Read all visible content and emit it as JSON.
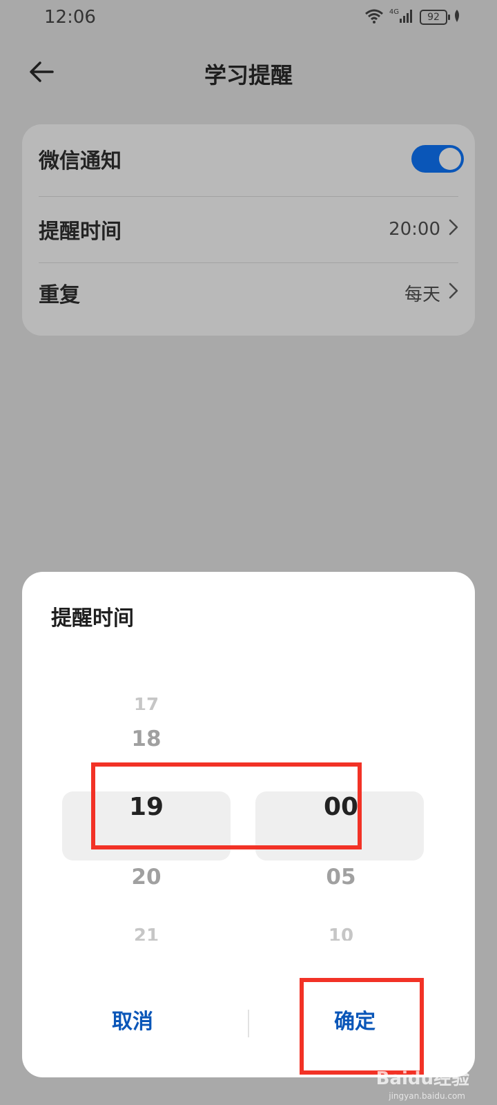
{
  "status_bar": {
    "time": "12:06",
    "network": "4G",
    "battery": "92",
    "icons": [
      "wifi-icon",
      "signal-icon",
      "battery-icon",
      "leaf-icon"
    ]
  },
  "header": {
    "title": "学习提醒",
    "back_icon": "arrow-left-icon"
  },
  "settings": {
    "wechat_notify": {
      "label": "微信通知",
      "toggle_on": true
    },
    "remind_time": {
      "label": "提醒时间",
      "value": "20:00"
    },
    "repeat": {
      "label": "重复",
      "value": "每天"
    }
  },
  "dialog": {
    "title": "提醒时间",
    "hours": {
      "above2": "17",
      "above1": "18",
      "selected": "19",
      "below1": "20",
      "below2": "21"
    },
    "minutes": {
      "selected": "00",
      "below1": "05",
      "below2": "10"
    },
    "cancel_label": "取消",
    "confirm_label": "确定"
  },
  "colors": {
    "accent": "#0a56b8",
    "highlight": "#f23226",
    "scrim": "#a9a9a9"
  },
  "watermark": {
    "text": "Baidu经验",
    "url": "jingyan.baidu.com"
  }
}
